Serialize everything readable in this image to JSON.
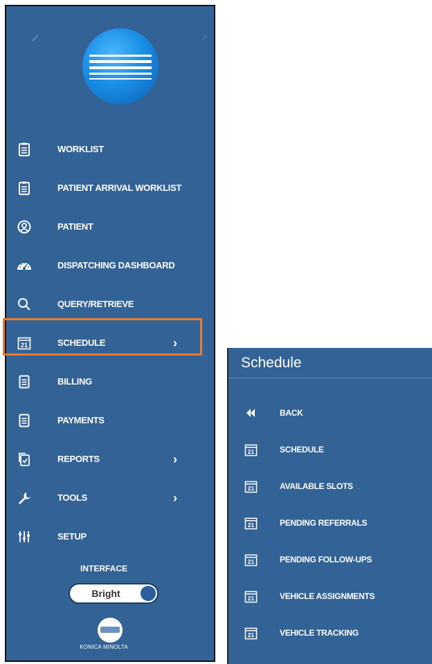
{
  "menu": {
    "items": [
      {
        "label": "WORKLIST",
        "icon": "clipboard-icon"
      },
      {
        "label": "PATIENT ARRIVAL WORKLIST",
        "icon": "clipboard-icon"
      },
      {
        "label": "PATIENT",
        "icon": "user-circle-icon"
      },
      {
        "label": "DISPATCHING DASHBOARD",
        "icon": "dashboard-gauge-icon"
      },
      {
        "label": "QUERY/RETRIEVE",
        "icon": "search-icon"
      },
      {
        "label": "SCHEDULE",
        "icon": "calendar-icon",
        "chevron": "›",
        "selected": true
      },
      {
        "label": "BILLING",
        "icon": "document-icon"
      },
      {
        "label": "PAYMENTS",
        "icon": "document-icon"
      },
      {
        "label": "REPORTS",
        "icon": "reports-icon",
        "chevron": "›"
      },
      {
        "label": "TOOLS",
        "icon": "wrench-icon",
        "chevron": "›"
      },
      {
        "label": "SETUP",
        "icon": "sliders-icon"
      }
    ],
    "calendar_day": "21"
  },
  "interface": {
    "label": "INTERFACE",
    "toggle_value": "Bright"
  },
  "brand": {
    "text": "KONICA MINOLTA"
  },
  "submenu": {
    "title": "Schedule",
    "items": [
      {
        "label": "BACK",
        "icon": "double-chevron-left-icon"
      },
      {
        "label": "SCHEDULE",
        "icon": "calendar-icon"
      },
      {
        "label": "AVAILABLE SLOTS",
        "icon": "calendar-icon"
      },
      {
        "label": "PENDING REFERRALS",
        "icon": "calendar-icon"
      },
      {
        "label": "PENDING FOLLOW-UPS",
        "icon": "calendar-icon"
      },
      {
        "label": "VEHICLE ASSIGNMENTS",
        "icon": "calendar-icon"
      },
      {
        "label": "VEHICLE TRACKING",
        "icon": "calendar-icon"
      }
    ]
  },
  "colors": {
    "panel_bg": "#336396",
    "highlight_border": "#ee7a2a",
    "text": "#ffffff"
  }
}
